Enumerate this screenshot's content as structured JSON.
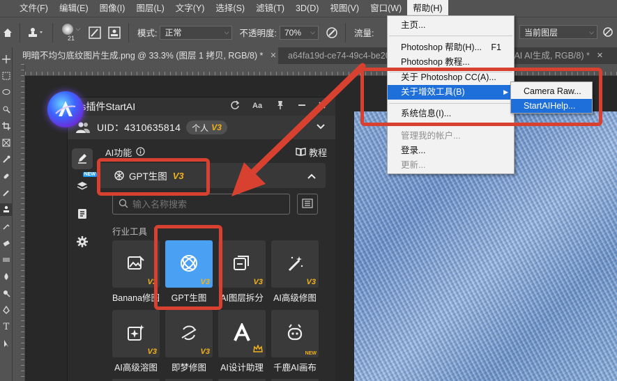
{
  "menubar": {
    "items": [
      "文件(F)",
      "编辑(E)",
      "图像(I)",
      "图层(L)",
      "文字(Y)",
      "选择(S)",
      "滤镜(T)",
      "3D(D)",
      "视图(V)",
      "窗口(W)",
      "帮助(H)"
    ]
  },
  "optbar": {
    "brush_size": "21",
    "mode_label": "模式:",
    "mode_value": "正常",
    "opacity_label": "不透明度:",
    "opacity_value": "70%",
    "flow_label": "流量:",
    "sample_value": "当前图层"
  },
  "tabs": [
    {
      "label": "明暗不均匀底纹图片生成.png @ 33.3% (图层 1 拷贝, RGB/8) *",
      "close": "✕"
    },
    {
      "label": "a64fa19d-ce74-49c4-be20"
    },
    {
      "label": "tAI AI生成, RGB/8) *",
      "close": "✕"
    }
  ],
  "plugin": {
    "title": "Ps插件StartAI",
    "uid": "UID：4310635814",
    "tier": "个人",
    "tier_badge": "V3",
    "sidebar_new_badge": "NEW",
    "ai_function": "AI功能",
    "tutorial": "教程",
    "section_title": "GPT生图",
    "section_badge": "V3",
    "search_placeholder": "输入名称搜索",
    "category": "行业工具",
    "cards": [
      {
        "label": "Banana修图",
        "badge": "V3"
      },
      {
        "label": "GPT生图",
        "badge": "V3"
      },
      {
        "label": "AI图层拆分",
        "badge": "V3"
      },
      {
        "label": "AI高级修图",
        "badge": "V3"
      },
      {
        "label": "AI高级溶图",
        "badge": "V3"
      },
      {
        "label": "即梦修图",
        "badge": "V3"
      },
      {
        "label": "AI设计助理",
        "badge": ""
      },
      {
        "label": "千鹿AI画布",
        "badge": "NEW"
      }
    ]
  },
  "help_menu": {
    "items": [
      {
        "label": "主页..."
      },
      {
        "label": "Photoshop 帮助(H)...",
        "shortcut": "F1"
      },
      {
        "label": "Photoshop 教程..."
      },
      {
        "label": "关于 Photoshop CC(A)..."
      },
      {
        "label": "关于增效工具(B)"
      },
      {
        "label": "系统信息(I)..."
      },
      {
        "label": "管理我的帐户..."
      },
      {
        "label": "登录..."
      },
      {
        "label": "更新..."
      }
    ],
    "submenu": [
      "Camera Raw...",
      "StartAIHelp..."
    ]
  },
  "colors": {
    "highlight": "#1e6fd9",
    "annotation_red": "#d8412f",
    "badge_gold": "#f2b21b",
    "active_card": "#4aa0f2"
  }
}
